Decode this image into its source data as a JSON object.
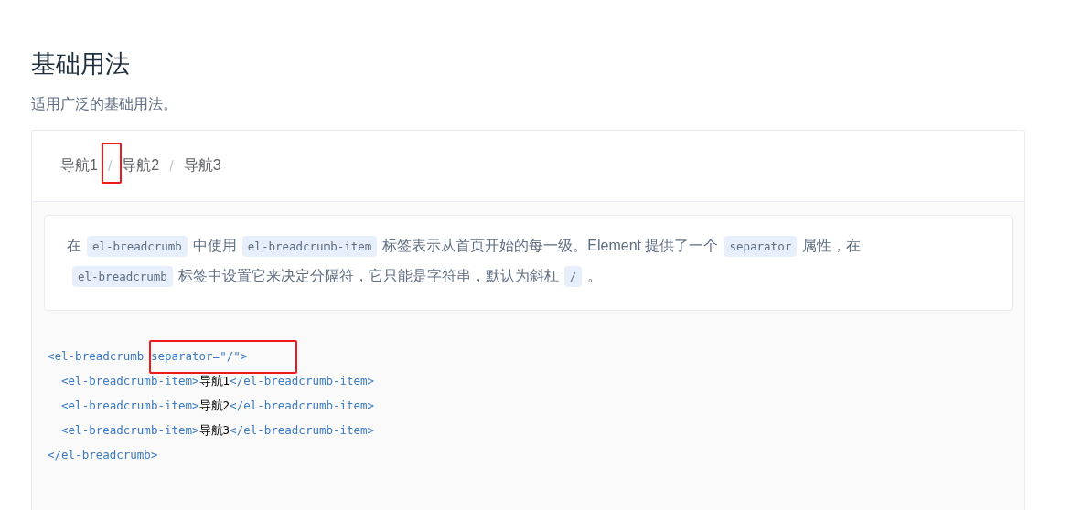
{
  "title": "基础用法",
  "subtitle": "适用广泛的基础用法。",
  "breadcrumb": {
    "items": [
      {
        "label": "导航1"
      },
      {
        "label": "导航2"
      },
      {
        "label": "导航3"
      }
    ],
    "separator": "/"
  },
  "tip": [
    {
      "kind": "text",
      "text": "在"
    },
    {
      "kind": "code",
      "text": "el-breadcrumb"
    },
    {
      "kind": "text",
      "text": "中使用"
    },
    {
      "kind": "code",
      "text": "el-breadcrumb-item"
    },
    {
      "kind": "text",
      "text": "标签表示从首页开始的每一级。Element 提供了一个"
    },
    {
      "kind": "code",
      "text": "separator"
    },
    {
      "kind": "text",
      "text": "属性，在"
    },
    {
      "kind": "code",
      "text": "el-breadcrumb"
    },
    {
      "kind": "text",
      "text": "标签中设置它来决定分隔符，它只能是字符串，默认为斜杠"
    },
    {
      "kind": "code",
      "text": "/"
    },
    {
      "kind": "text",
      "text": "。"
    }
  ],
  "code_lines": [
    [
      {
        "kind": "tag",
        "text": "<el-breadcrumb"
      },
      {
        "kind": "tag",
        "text": " separator=\"/\">"
      }
    ],
    [
      {
        "kind": "tag",
        "text": "  <el-breadcrumb-item>"
      },
      {
        "kind": "text",
        "text": "导航1"
      },
      {
        "kind": "tag",
        "text": "</el-breadcrumb-item>"
      }
    ],
    [
      {
        "kind": "tag",
        "text": "  <el-breadcrumb-item>"
      },
      {
        "kind": "text",
        "text": "导航2"
      },
      {
        "kind": "tag",
        "text": "</el-breadcrumb-item>"
      }
    ],
    [
      {
        "kind": "tag",
        "text": "  <el-breadcrumb-item>"
      },
      {
        "kind": "text",
        "text": "导航3"
      },
      {
        "kind": "tag",
        "text": "</el-breadcrumb-item>"
      }
    ],
    [
      {
        "kind": "tag",
        "text": "</el-breadcrumb>"
      }
    ]
  ]
}
